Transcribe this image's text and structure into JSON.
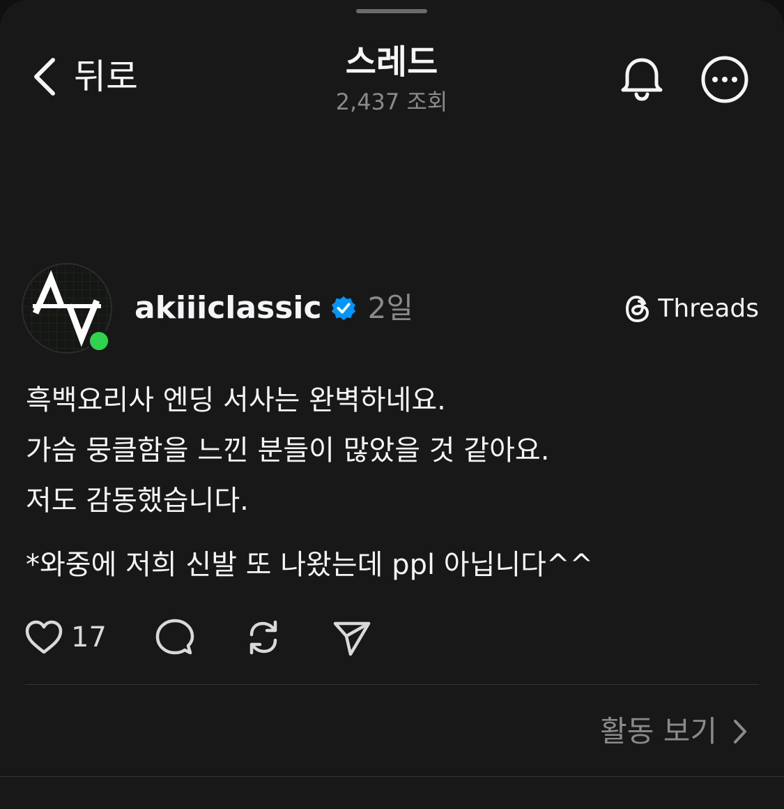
{
  "header": {
    "back_label": "뒤로",
    "title": "스레드",
    "views": "2,437 조회",
    "icons": {
      "back": "chevron-left-icon",
      "notifications": "bell-icon",
      "more": "more-circle-icon"
    }
  },
  "post": {
    "username": "akiiiclassic",
    "verified": true,
    "age": "2일",
    "source_label": "Threads",
    "lines": [
      "흑백요리사 엔딩 서사는 완벽하네요.",
      "가슴 뭉클함을 느낀 분들이 많았을 것 같아요.",
      "저도 감동했습니다."
    ],
    "note": "*와중에 저희 신발 또 나왔는데 ppl 아닙니다^^",
    "like_count": "17",
    "online": true
  },
  "footer": {
    "activity_label": "활동 보기"
  },
  "colors": {
    "background": "#181818",
    "text_primary": "#f3f5f7",
    "text_secondary": "#8a8a8a",
    "verified_blue": "#0095f6",
    "online_green": "#2fd34e"
  }
}
